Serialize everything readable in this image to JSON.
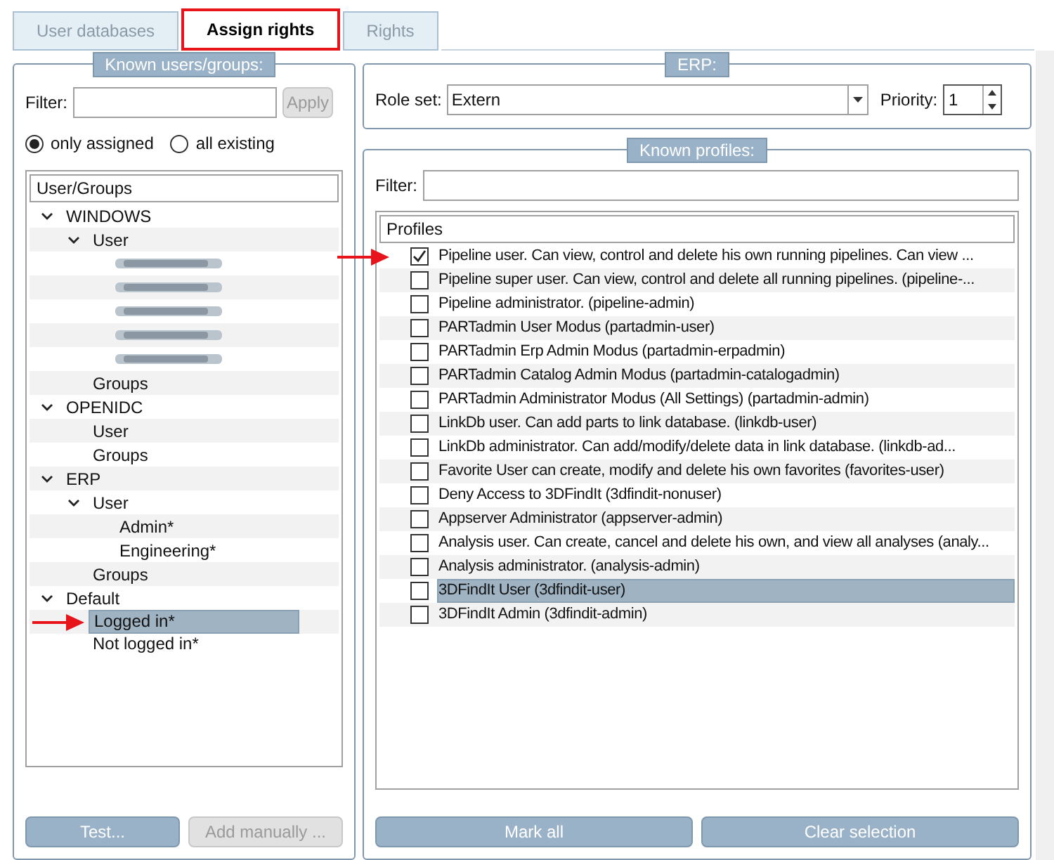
{
  "tabs": [
    {
      "label": "User databases",
      "selected": false,
      "highlighted": false
    },
    {
      "label": "Assign rights",
      "selected": true,
      "highlighted": true
    },
    {
      "label": "Rights",
      "selected": false,
      "highlighted": false
    }
  ],
  "users_panel": {
    "title": "Known users/groups:",
    "filter_label": "Filter:",
    "apply_button": {
      "label": "Apply",
      "disabled": true
    },
    "radios": [
      {
        "label": "only assigned",
        "selected": true
      },
      {
        "label": "all existing",
        "selected": false
      }
    ],
    "tree_header": "User/Groups",
    "tree": [
      {
        "label": "WINDOWS",
        "expanded": true,
        "children": [
          {
            "label": "User",
            "expanded": true,
            "children": [
              {
                "kind": "redacted"
              },
              {
                "kind": "redacted"
              },
              {
                "kind": "redacted"
              },
              {
                "kind": "redacted"
              },
              {
                "kind": "redacted"
              }
            ]
          },
          {
            "label": "Groups"
          }
        ]
      },
      {
        "label": "OPENIDC",
        "expanded": true,
        "children": [
          {
            "label": "User"
          },
          {
            "label": "Groups"
          }
        ]
      },
      {
        "label": "ERP",
        "expanded": true,
        "children": [
          {
            "label": "User",
            "expanded": true,
            "children": [
              {
                "label": "Admin*"
              },
              {
                "label": "Engineering*"
              }
            ]
          },
          {
            "label": "Groups"
          }
        ]
      },
      {
        "label": "Default",
        "expanded": true,
        "children": [
          {
            "label": "Logged in*",
            "selected": true,
            "pointer": true
          },
          {
            "label": "Not logged in*",
            "selected": false
          }
        ]
      }
    ],
    "buttons": [
      {
        "label": "Test...",
        "disabled": false
      },
      {
        "label": "Add manually ...",
        "disabled": true
      }
    ]
  },
  "erp_panel": {
    "title": "ERP:",
    "role_set_label": "Role set:",
    "role_set_value": "Extern",
    "priority_label": "Priority:",
    "priority_value": "1"
  },
  "profiles_panel": {
    "title": "Known profiles:",
    "filter_label": "Filter:",
    "list_header": "Profiles",
    "profiles": [
      {
        "label": "Pipeline user. Can view, control and delete his own running pipelines. Can view ...",
        "checked": true,
        "selected": false,
        "pointer": true
      },
      {
        "label": "Pipeline super user. Can view, control and delete all running pipelines. (pipeline-...",
        "checked": false,
        "selected": false,
        "pointer": false
      },
      {
        "label": "Pipeline administrator. (pipeline-admin)",
        "checked": false,
        "selected": false,
        "pointer": false
      },
      {
        "label": "PARTadmin User Modus (partadmin-user)",
        "checked": false,
        "selected": false,
        "pointer": false
      },
      {
        "label": "PARTadmin Erp Admin Modus (partadmin-erpadmin)",
        "checked": false,
        "selected": false,
        "pointer": false
      },
      {
        "label": "PARTadmin Catalog Admin Modus (partadmin-catalogadmin)",
        "checked": false,
        "selected": false,
        "pointer": false
      },
      {
        "label": "PARTadmin Administrator Modus (All Settings) (partadmin-admin)",
        "checked": false,
        "selected": false,
        "pointer": false
      },
      {
        "label": "LinkDb user. Can add parts to link database. (linkdb-user)",
        "checked": false,
        "selected": false,
        "pointer": false
      },
      {
        "label": "LinkDb administrator. Can add/modify/delete data in link database. (linkdb-ad...",
        "checked": false,
        "selected": false,
        "pointer": false
      },
      {
        "label": "Favorite User can create, modify and delete his own favorites (favorites-user)",
        "checked": false,
        "selected": false,
        "pointer": false
      },
      {
        "label": "Deny Access to 3DFindIt (3dfindit-nonuser)",
        "checked": false,
        "selected": false,
        "pointer": false
      },
      {
        "label": "Appserver Administrator (appserver-admin)",
        "checked": false,
        "selected": false,
        "pointer": false
      },
      {
        "label": "Analysis user. Can create, cancel and delete his own, and view all analyses (analy...",
        "checked": false,
        "selected": false,
        "pointer": false
      },
      {
        "label": "Analysis administrator. (analysis-admin)",
        "checked": false,
        "selected": false,
        "pointer": false
      },
      {
        "label": "3DFindIt User (3dfindit-user)",
        "checked": false,
        "selected": true,
        "pointer": false
      },
      {
        "label": "3DFindIt Admin (3dfindit-admin)",
        "checked": false,
        "selected": false,
        "pointer": false
      }
    ],
    "buttons": [
      {
        "label": "Mark all",
        "disabled": false
      },
      {
        "label": "Clear selection",
        "disabled": false
      }
    ]
  }
}
